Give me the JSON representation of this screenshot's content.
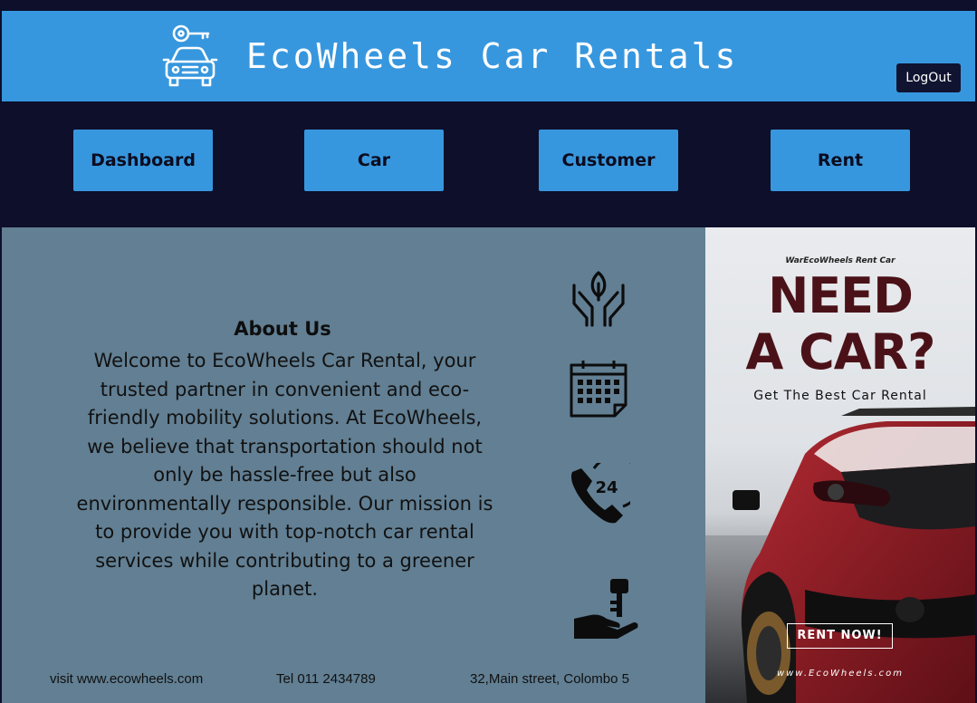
{
  "header": {
    "title": "EcoWheels Car Rentals",
    "logo_icon": "car-key-icon",
    "logout_label": "LogOut"
  },
  "nav": {
    "items": [
      {
        "label": "Dashboard"
      },
      {
        "label": "Car"
      },
      {
        "label": "Customer"
      },
      {
        "label": "Rent"
      }
    ]
  },
  "about": {
    "title": "About Us",
    "lines": [
      "Welcome to EcoWheels Car Rental, your",
      "trusted partner in convenient and eco-",
      "friendly mobility solutions. At EcoWheels,",
      "we believe that transportation should not",
      "only be hassle-free but also",
      "environmentally responsible. Our mission is",
      "to provide you with top-notch car rental",
      "services while contributing to a greener",
      "planet."
    ]
  },
  "features": {
    "icons": [
      "eco-hands-icon",
      "calendar-icon",
      "phone-24-icon",
      "key-hand-icon"
    ],
    "phone_badge": "24"
  },
  "footer": {
    "website": "visit www.ecowheels.com",
    "phone": "Tel 011 2434789",
    "address": "32,Main street, Colombo 5"
  },
  "ad": {
    "brand": "WarEcoWheels  Rent Car",
    "headline_1": "NEED",
    "headline_2": "A CAR?",
    "tagline": "Get The Best Car Rental",
    "cta": "RENT NOW!",
    "url": "www.EcoWheels.com"
  },
  "colors": {
    "header_bg": "#3797de",
    "nav_bg": "#0d0f2b",
    "main_bg": "#627f93",
    "ad_headline": "#4a1218",
    "car_red": "#8c1b24"
  }
}
